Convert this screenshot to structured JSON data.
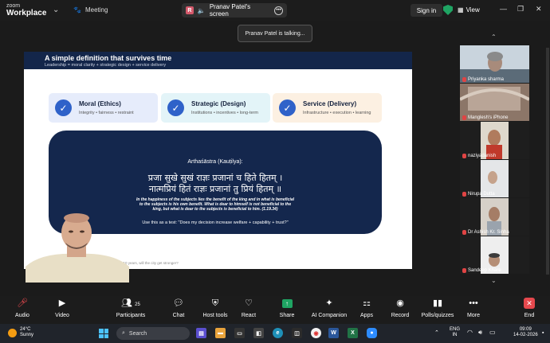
{
  "app": {
    "brand_line1": "zoom",
    "brand_line2": "Workplace",
    "meeting_label": "Meeting"
  },
  "share": {
    "badge": "R",
    "label": "Pranav Patel's screen"
  },
  "topbar": {
    "sign_in": "Sign in",
    "view": "View"
  },
  "talking": "Pranav Patel is talking...",
  "slide": {
    "title": "A simple definition that survives time",
    "subtitle": "Leadership = moral clarity + strategic design + service delivery",
    "cards": [
      {
        "title": "Moral (Ethics)",
        "sub": "Integrity • fairness • restraint"
      },
      {
        "title": "Strategic (Design)",
        "sub": "Institutions • incentives • long-term"
      },
      {
        "title": "Service (Delivery)",
        "sub": "Infrastructure • execution • learning"
      }
    ],
    "quote_heading": "Arthaśāstra (Kauṭilya):",
    "sanskrit_1": "प्रजा सुखे सुखं राज्ञः प्रजानां च हिते हितम् ।",
    "sanskrit_2": "नात्मप्रियं हितं राज्ञः प्रजानां तु प्रियं हितम् ॥",
    "english": "In the happiness of the subjects lies the benefit of the king and in what is beneficial to the subjects is his own benefit. What is dear to himself is not beneficial to the king, but what is dear to the subjects is beneficial to him. (1.19.34)",
    "test": "Use this as a test: \"Does my decision increase welfare + capability + trust?\"",
    "footer": "for 10 years, will the city get stronger?"
  },
  "participants": [
    {
      "name": "Priyanka sharma"
    },
    {
      "name": "Manglesh's iPhone"
    },
    {
      "name": "naziyadanish"
    },
    {
      "name": "Nirupa Dutta"
    },
    {
      "name": "Dr Ashish Kr. Sinha"
    },
    {
      "name": "Sandeep Khare"
    }
  ],
  "controls": {
    "audio": "Audio",
    "video": "Video",
    "participants": "Participants",
    "participants_count": "25",
    "chat": "Chat",
    "host_tools": "Host tools",
    "react": "React",
    "share": "Share",
    "ai_companion": "AI Companion",
    "apps": "Apps",
    "record": "Record",
    "polls": "Polls/quizzes",
    "more": "More",
    "end": "End"
  },
  "taskbar": {
    "temp": "24°C",
    "weather": "Sunny",
    "search": "Search",
    "lang1": "ENG",
    "lang2": "IN",
    "time": "09:09",
    "date": "14-02-2026"
  }
}
